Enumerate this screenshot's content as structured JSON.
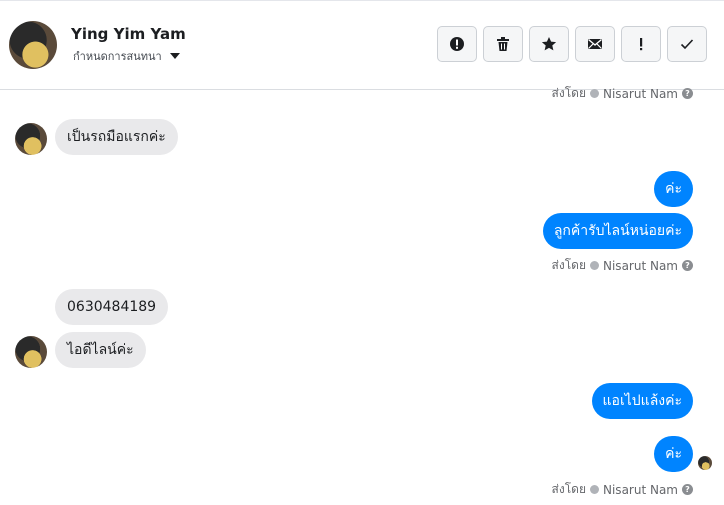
{
  "header": {
    "contact_name": "Ying Yim Yam",
    "subtitle": "กำหนดการสนทนา",
    "actions": [
      {
        "icon": "alert-circle-icon"
      },
      {
        "icon": "trash-icon"
      },
      {
        "icon": "star-icon"
      },
      {
        "icon": "envelope-icon"
      },
      {
        "icon": "exclamation-icon"
      },
      {
        "icon": "check-icon"
      }
    ]
  },
  "messages": {
    "sent_by_label": "ส่งโดย",
    "agent_name": "Nisarut Nam",
    "m1": "เป็นรถมือแรกค่ะ",
    "m2": "ค่ะ",
    "m3": "ลูกค้ารับไลน์หน่อยค่ะ",
    "m4": "0630484189",
    "m5": "ไอดีไลน์ค่ะ",
    "m6": "แอเไปแล้งค่ะ",
    "m7": "ค่ะ"
  },
  "colors": {
    "outgoing_bubble": "#0084ff",
    "incoming_bubble": "#e9e9eb"
  }
}
